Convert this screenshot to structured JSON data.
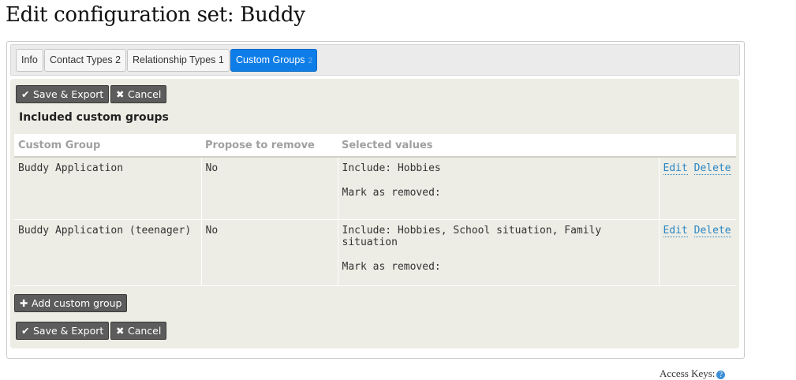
{
  "page": {
    "title": "Edit configuration set: Buddy"
  },
  "tabs": [
    {
      "label": "Info",
      "active": false
    },
    {
      "label": "Contact Types 2",
      "active": false
    },
    {
      "label": "Relationship Types 1",
      "active": false
    },
    {
      "label": "Custom Groups",
      "badge": "2",
      "active": true
    }
  ],
  "toolbar": {
    "save_label": "Save & Export",
    "cancel_label": "Cancel"
  },
  "section": {
    "title": "Included custom groups"
  },
  "table": {
    "headers": [
      "Custom Group",
      "Propose to remove",
      "Selected values",
      ""
    ],
    "rows": [
      {
        "custom_group": "Buddy Application",
        "propose_to_remove": "No",
        "include": "Include: Hobbies",
        "mark_removed": "Mark as removed:",
        "edit": "Edit",
        "delete": "Delete"
      },
      {
        "custom_group": "Buddy Application (teenager)",
        "propose_to_remove": "No",
        "include": "Include: Hobbies, School situation, Family situation",
        "mark_removed": "Mark as removed:",
        "edit": "Edit",
        "delete": "Delete"
      }
    ]
  },
  "add_button": {
    "label": "Add custom group"
  },
  "footer": {
    "access_keys": "Access Keys:"
  },
  "colors": {
    "accent": "#0e7de8",
    "button": "#5c5c5c",
    "panel": "#edede5",
    "link": "#2a86c4"
  },
  "icons": {
    "save": "check-icon",
    "cancel": "close-icon",
    "add": "plus-icon",
    "help": "help-icon"
  }
}
